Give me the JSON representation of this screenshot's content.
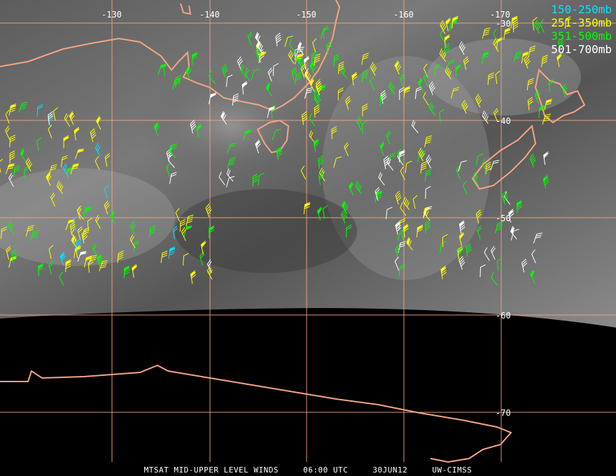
{
  "longitude_labels": [
    "-130",
    "-140",
    "-150",
    "-160",
    "-170"
  ],
  "latitude_labels": [
    "-30",
    "-40",
    "-50",
    "-60",
    "-70"
  ],
  "legend": [
    {
      "label": "150-250mb",
      "color": "#00e5ff"
    },
    {
      "label": "251-350mb",
      "color": "#ffff00"
    },
    {
      "label": "351-500mb",
      "color": "#00ff00"
    },
    {
      "label": "501-700mb",
      "color": "#ffffff"
    }
  ],
  "footer": {
    "product": "MTSAT MID-UPPER LEVEL WINDS",
    "time": "06:00 UTC",
    "date": "30JUN12",
    "source": "UW-CIMSS"
  },
  "colors": {
    "grid": "#f4a582",
    "coastline": "#f4a582",
    "background": "#000000"
  }
}
